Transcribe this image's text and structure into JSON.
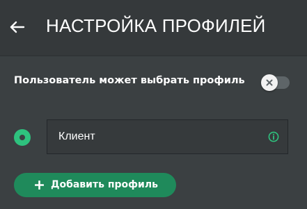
{
  "header": {
    "back_icon": "arrow-left-icon",
    "title": "НАСТРОЙКА ПРОФИЛЕЙ"
  },
  "settings": {
    "allow_user_choose_label": "Пользователь может выбрать профиль",
    "allow_user_choose_enabled": false,
    "toggle_icon": "close-icon"
  },
  "profiles": [
    {
      "name": "Клиент",
      "selected": true,
      "info_icon": "info-icon"
    }
  ],
  "actions": {
    "add_profile_label": "Добавить профиль",
    "add_icon": "plus-icon"
  },
  "colors": {
    "background": "#3b4042",
    "header_background": "#35393b",
    "accent_green": "#2ec27e",
    "button_green": "#1f8a5b",
    "toggle_track": "#5e6568"
  }
}
